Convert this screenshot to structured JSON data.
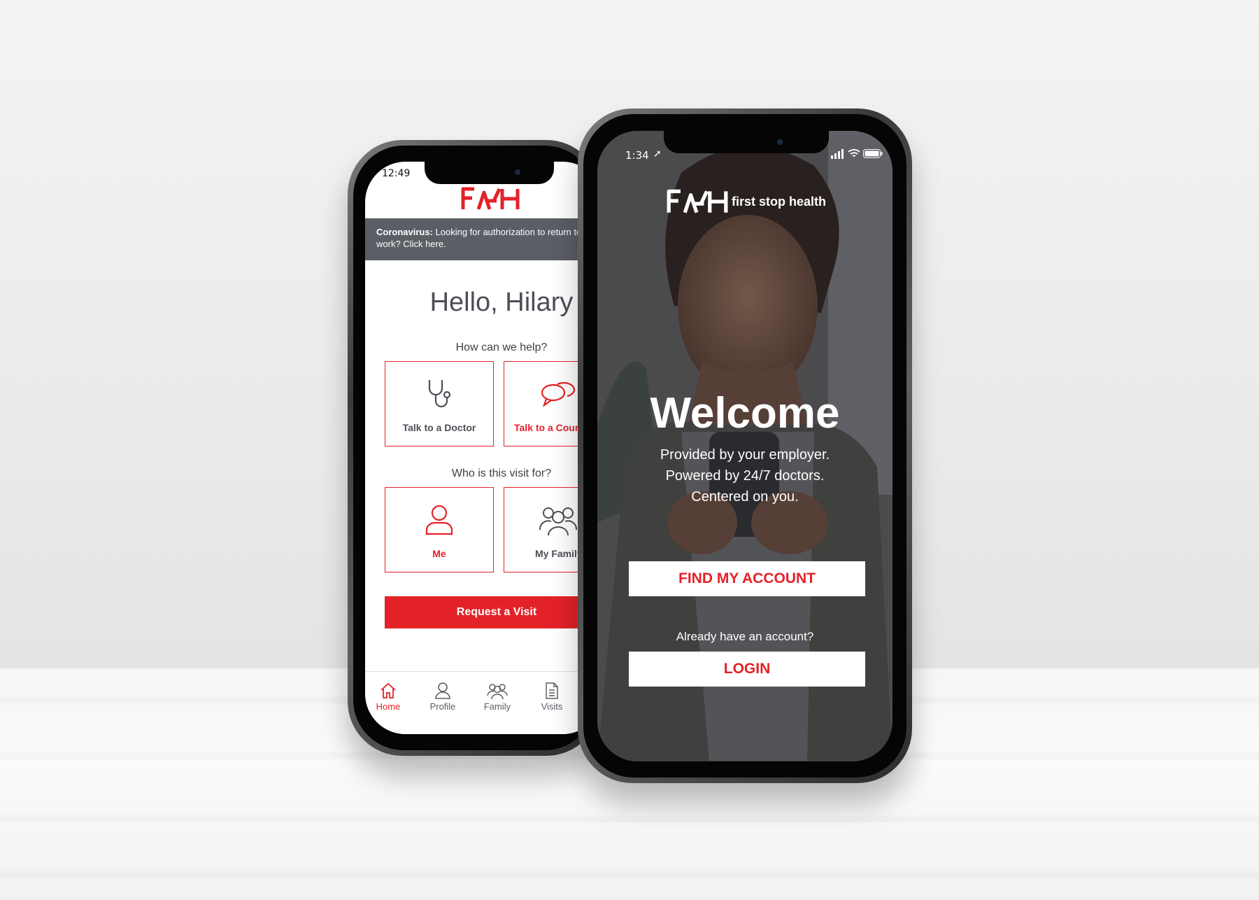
{
  "back_phone": {
    "status_time": "12:49",
    "alert": {
      "bold": "Coronavirus:",
      "text": " Looking for authorization to return to work? Click here."
    },
    "greeting": "Hello, Hilary",
    "help_prompt": "How can we help?",
    "help_tiles": [
      {
        "label": "Talk to a Doctor",
        "icon": "stethoscope-icon"
      },
      {
        "label": "Talk to a Counselor",
        "icon": "chat-bubbles-icon"
      }
    ],
    "visit_prompt": "Who is this visit for?",
    "visit_tiles": [
      {
        "label": "Me",
        "icon": "person-icon"
      },
      {
        "label": "My Family",
        "icon": "family-icon"
      }
    ],
    "request_button": "Request a Visit",
    "tabs": [
      {
        "label": "Home",
        "icon": "home-icon",
        "active": true
      },
      {
        "label": "Profile",
        "icon": "profile-icon",
        "active": false
      },
      {
        "label": "Family",
        "icon": "family-icon",
        "active": false
      },
      {
        "label": "Visits",
        "icon": "document-icon",
        "active": false
      }
    ]
  },
  "front_phone": {
    "status_time": "1:34",
    "brand_text": "first stop health",
    "welcome": "Welcome",
    "tagline": [
      "Provided by your employer.",
      "Powered by 24/7 doctors.",
      "Centered on you."
    ],
    "find_account_button": "FIND MY ACCOUNT",
    "already_text": "Already have an account?",
    "login_button": "LOGIN"
  },
  "colors": {
    "brand_red": "#e32228",
    "alert_gray": "#5c5e66",
    "text_dark": "#4d4f57"
  }
}
